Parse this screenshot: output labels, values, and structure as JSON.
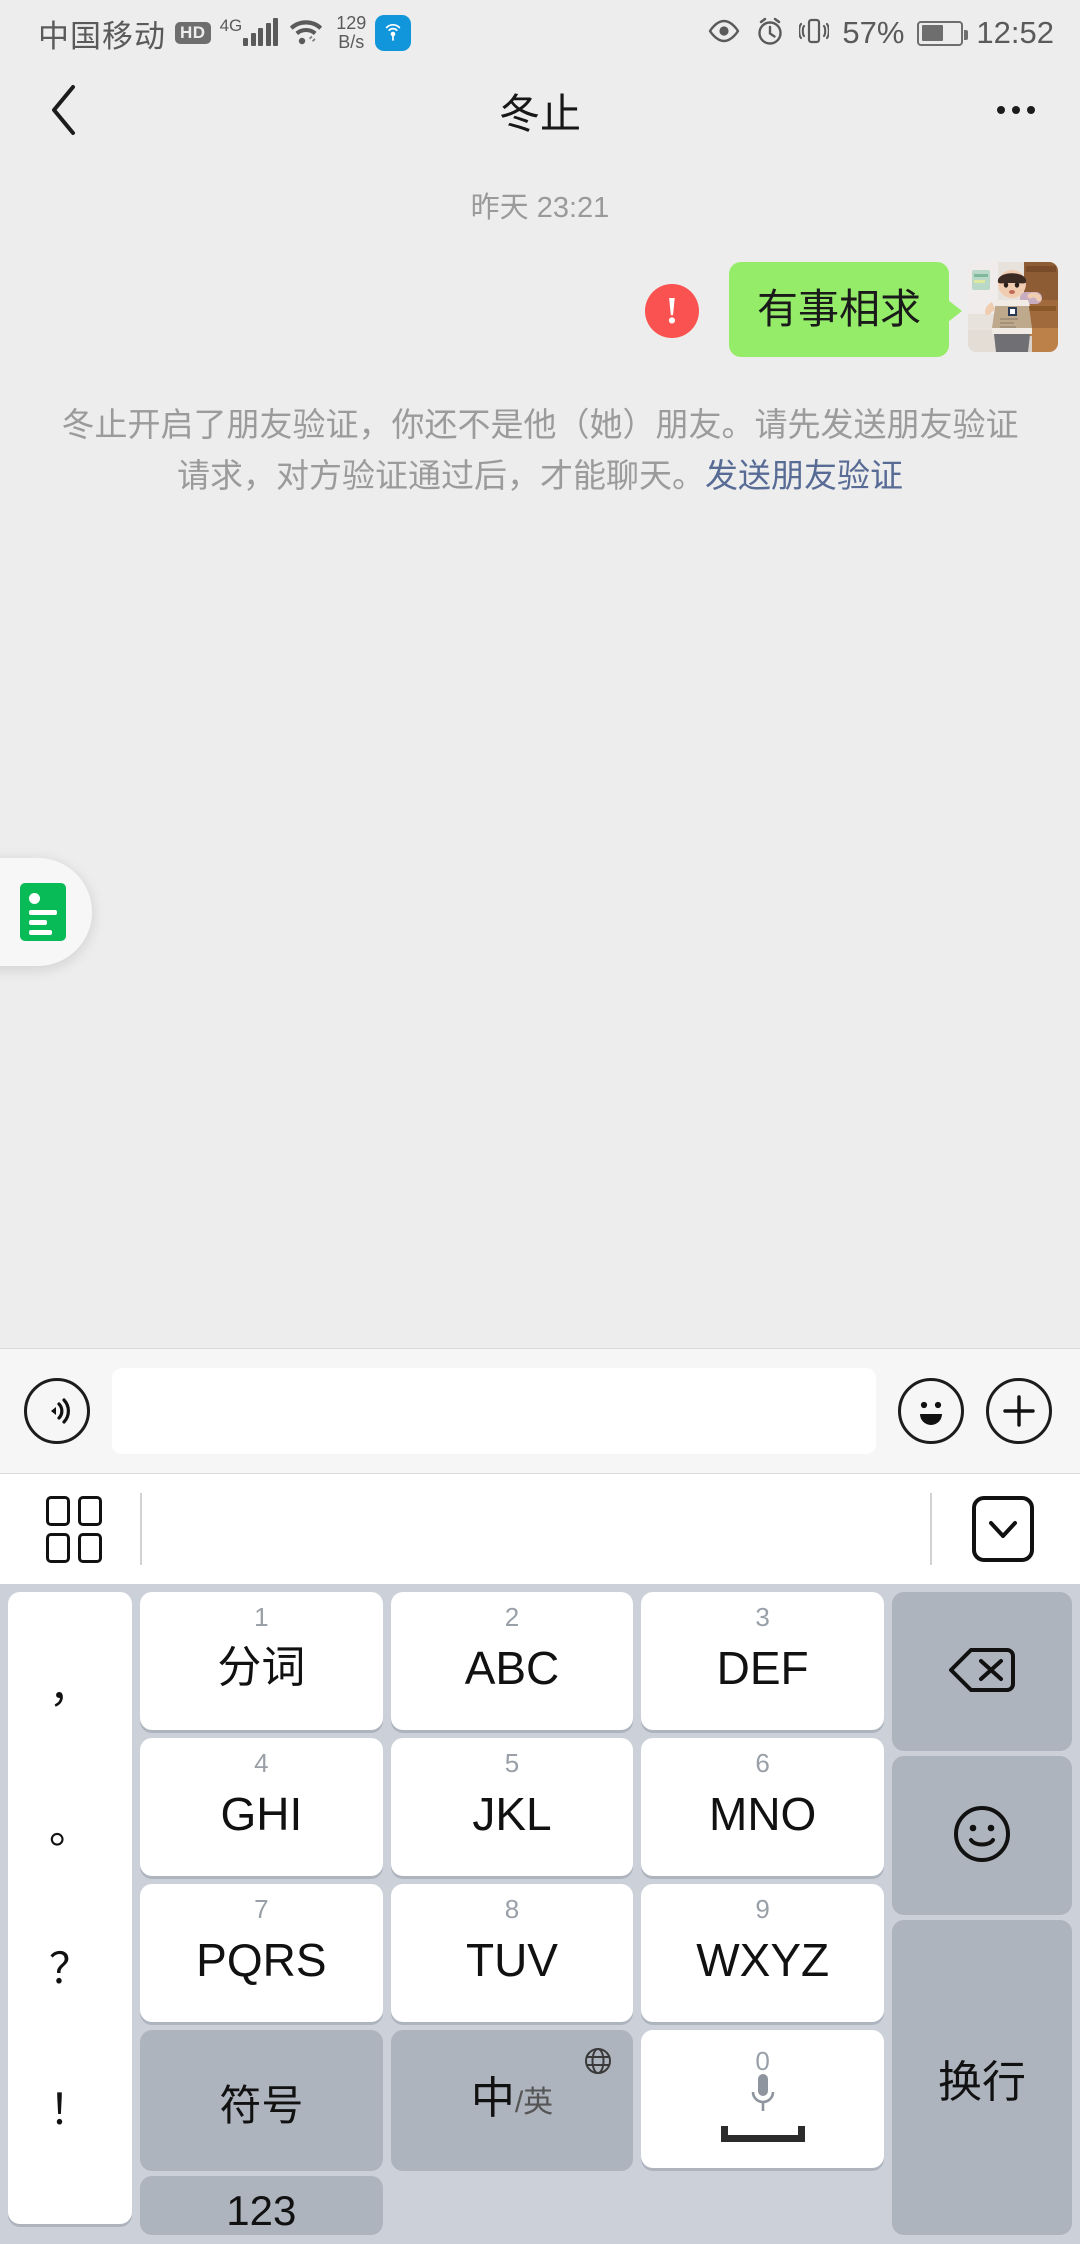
{
  "status_bar": {
    "carrier": "中国移动",
    "hd_badge": "HD",
    "network_type": "4G",
    "data_speed_value": "129",
    "data_speed_unit": "B/s",
    "hotspot_icon": "hotspot-icon",
    "eye_icon": "eye-comfort-icon",
    "alarm_icon": "alarm-clock-icon",
    "vibrate_icon": "vibrate-icon",
    "battery_percent": "57%",
    "battery_level": 57,
    "time": "12:52"
  },
  "nav_bar": {
    "back_icon": "chevron-left-icon",
    "title": "冬止",
    "more_icon": "more-options-icon"
  },
  "chat": {
    "timestamp": "昨天 23:21",
    "message": {
      "text": "有事相求",
      "send_failed": true,
      "error_glyph": "!",
      "bubble_color": "#95ec69",
      "error_color": "#fa5151"
    },
    "system_notice": {
      "text": "冬止开启了朋友验证，你还不是他（她）朋友。请先发送朋友验证请求，对方验证通过后，才能聊天。",
      "link_text": "发送朋友验证",
      "link_color": "#576b95"
    },
    "float_widget": {
      "icon_name": "contact-card-icon",
      "icon_color": "#09bb57"
    }
  },
  "input_bar": {
    "voice_icon": "voice-input-icon",
    "input_value": "",
    "input_placeholder": "",
    "emoji_icon": "emoji-smiley-icon",
    "plus_icon": "more-functions-plus-icon"
  },
  "keyboard_toolbar": {
    "grid_icon": "keyboard-panel-grid-icon",
    "collapse_icon": "hide-keyboard-chevron-down-icon"
  },
  "keyboard": {
    "punct_key": {
      "name": "punctuation-key",
      "marks": [
        "，",
        "。",
        "？",
        "！"
      ]
    },
    "keys": [
      {
        "num": "1",
        "label": "分词",
        "cn": true
      },
      {
        "num": "2",
        "label": "ABC",
        "cn": false
      },
      {
        "num": "3",
        "label": "DEF",
        "cn": false
      },
      {
        "num": "4",
        "label": "GHI",
        "cn": false
      },
      {
        "num": "5",
        "label": "JKL",
        "cn": false
      },
      {
        "num": "6",
        "label": "MNO",
        "cn": false
      },
      {
        "num": "7",
        "label": "PQRS",
        "cn": false
      },
      {
        "num": "8",
        "label": "TUV",
        "cn": false
      },
      {
        "num": "9",
        "label": "WXYZ",
        "cn": false
      }
    ],
    "bottom_row": {
      "symbol_key": "符号",
      "lang_key_zh": "中",
      "lang_key_slash": "/",
      "lang_key_en": "英",
      "lang_globe_icon": "globe-icon",
      "space_key_num": "0",
      "space_mic_icon": "microphone-icon",
      "number_key": "123"
    },
    "right_column": {
      "backspace_icon": "backspace-delete-icon",
      "emoji_icon": "emoji-face-icon",
      "enter_label": "换行"
    },
    "colors": {
      "keyboard_bg": "#ccd1d9",
      "key_bg": "#ffffff",
      "fn_key_bg": "#aeb4be"
    }
  }
}
